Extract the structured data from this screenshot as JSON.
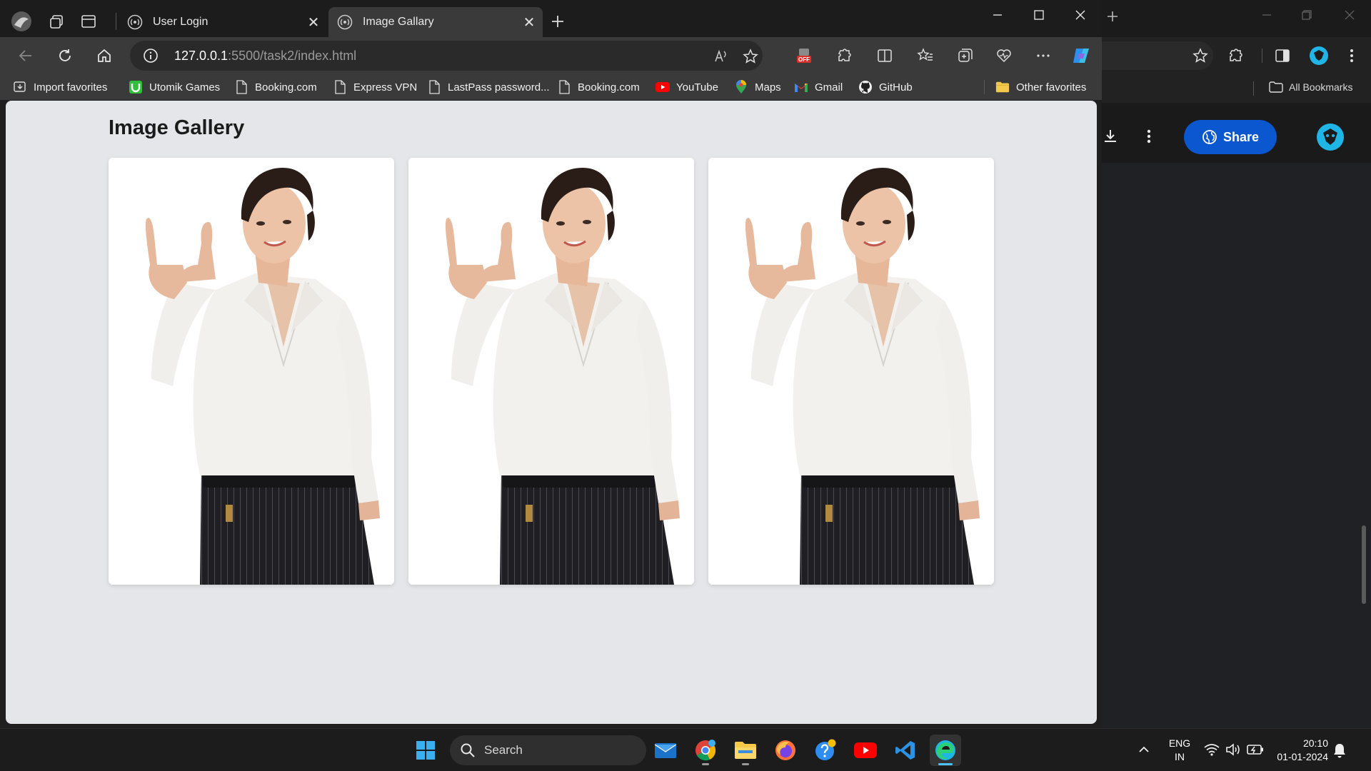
{
  "browser": {
    "tabs": [
      {
        "label": "User Login"
      },
      {
        "label": "Image Gallary"
      }
    ],
    "address": {
      "host": "127.0.0.1",
      "path": ":5500/task2/index.html"
    },
    "favorites": [
      {
        "label": "Import favorites",
        "icon": "import-favorites-icon"
      },
      {
        "label": "Utomik Games",
        "icon": "utomik-icon"
      },
      {
        "label": "Booking.com",
        "icon": "page-icon"
      },
      {
        "label": "Express VPN",
        "icon": "page-icon"
      },
      {
        "label": "LastPass password...",
        "icon": "page-icon"
      },
      {
        "label": "Booking.com",
        "icon": "page-icon"
      },
      {
        "label": "YouTube",
        "icon": "youtube-icon"
      },
      {
        "label": "Maps",
        "icon": "maps-icon"
      },
      {
        "label": "Gmail",
        "icon": "gmail-icon"
      },
      {
        "label": "GitHub",
        "icon": "github-icon"
      }
    ],
    "other_favorites": "Other favorites",
    "tracker_badge": "OFF"
  },
  "page": {
    "title": "Image Gallery",
    "images": [
      {
        "alt": "gallery-image-1"
      },
      {
        "alt": "gallery-image-2"
      },
      {
        "alt": "gallery-image-3"
      }
    ]
  },
  "background_window": {
    "all_bookmarks": "All Bookmarks",
    "share_label": "Share"
  },
  "taskbar": {
    "search_label": "Search",
    "language": "ENG",
    "region": "IN",
    "time": "20:10",
    "date": "01-01-2024"
  },
  "colors": {
    "page_bg": "#e5e6ea",
    "accent_blue": "#0b57d0",
    "edge_cyan": "#1fb5e6"
  }
}
